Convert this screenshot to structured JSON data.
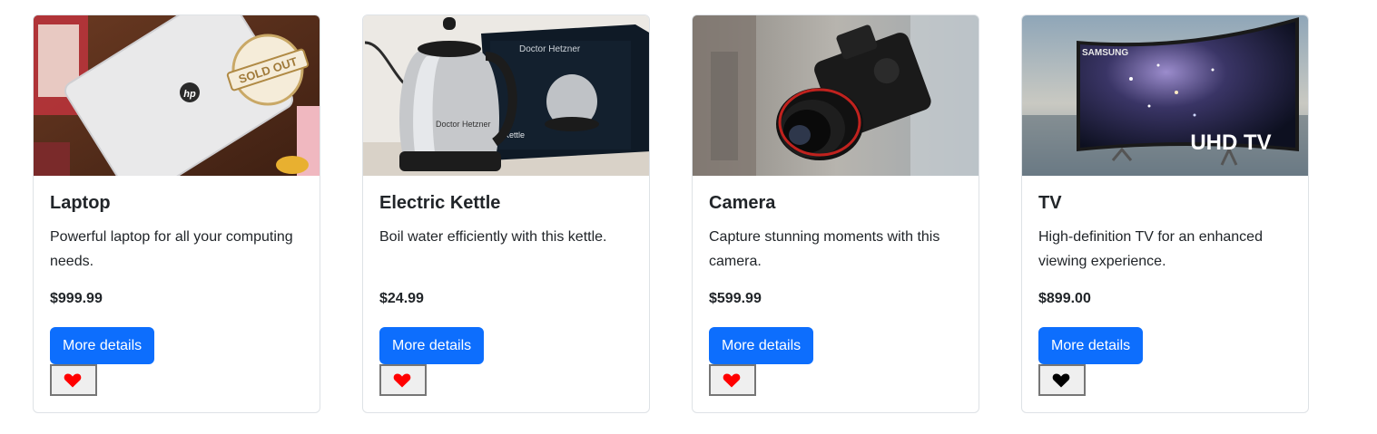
{
  "products": [
    {
      "title": "Laptop",
      "description": "Powerful laptop for all your computing needs.",
      "price": "$999.99",
      "button_label": "More details",
      "favorite_color": "#ff0000",
      "image_badge": "SOLD OUT",
      "image_logo": "hp"
    },
    {
      "title": "Electric Kettle",
      "description": "Boil water efficiently with this kettle.",
      "price": "$24.99",
      "button_label": "More details",
      "favorite_color": "#ff0000",
      "image_text": "Doctor Hetzner",
      "image_box_text": "Kettle"
    },
    {
      "title": "Camera",
      "description": "Capture stunning moments with this camera.",
      "price": "$599.99",
      "button_label": "More details",
      "favorite_color": "#ff0000"
    },
    {
      "title": "TV",
      "description": "High-definition TV for an enhanced viewing experience.",
      "price": "$899.00",
      "button_label": "More details",
      "favorite_color": "#000000",
      "image_brand": "SAMSUNG",
      "image_tv_text": "UHD TV"
    }
  ],
  "colors": {
    "button": "#0d6efd",
    "border": "#dee2e6"
  }
}
